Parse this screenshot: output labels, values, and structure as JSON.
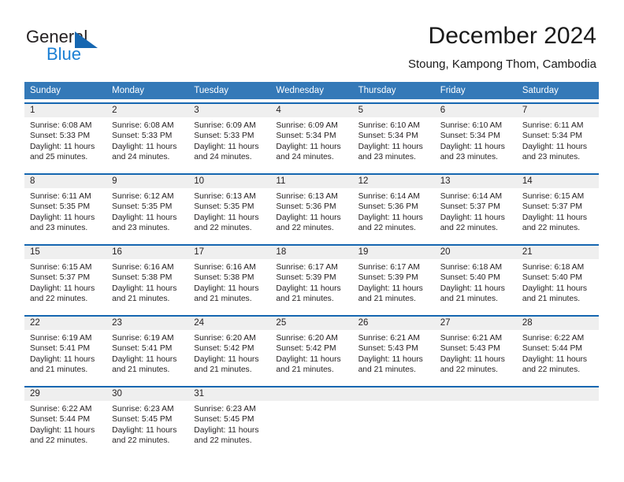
{
  "logo": {
    "word_one": "General",
    "word_two": "Blue",
    "triangle_icon": "triangle-icon",
    "blue": "#1667b1",
    "light_blue": "#1b7fd4"
  },
  "header": {
    "title": "December 2024",
    "subtitle": "Stoung, Kampong Thom, Cambodia"
  },
  "theme": {
    "header_bar": "#3479b8",
    "row_rule": "#1667b1",
    "day_band": "#efefef",
    "text": "#231f20"
  },
  "weekdays": [
    "Sunday",
    "Monday",
    "Tuesday",
    "Wednesday",
    "Thursday",
    "Friday",
    "Saturday"
  ],
  "weeks": [
    [
      {
        "day": "1",
        "sunrise": "Sunrise: 6:08 AM",
        "sunset": "Sunset: 5:33 PM",
        "daylight1": "Daylight: 11 hours",
        "daylight2": "and 25 minutes."
      },
      {
        "day": "2",
        "sunrise": "Sunrise: 6:08 AM",
        "sunset": "Sunset: 5:33 PM",
        "daylight1": "Daylight: 11 hours",
        "daylight2": "and 24 minutes."
      },
      {
        "day": "3",
        "sunrise": "Sunrise: 6:09 AM",
        "sunset": "Sunset: 5:33 PM",
        "daylight1": "Daylight: 11 hours",
        "daylight2": "and 24 minutes."
      },
      {
        "day": "4",
        "sunrise": "Sunrise: 6:09 AM",
        "sunset": "Sunset: 5:34 PM",
        "daylight1": "Daylight: 11 hours",
        "daylight2": "and 24 minutes."
      },
      {
        "day": "5",
        "sunrise": "Sunrise: 6:10 AM",
        "sunset": "Sunset: 5:34 PM",
        "daylight1": "Daylight: 11 hours",
        "daylight2": "and 23 minutes."
      },
      {
        "day": "6",
        "sunrise": "Sunrise: 6:10 AM",
        "sunset": "Sunset: 5:34 PM",
        "daylight1": "Daylight: 11 hours",
        "daylight2": "and 23 minutes."
      },
      {
        "day": "7",
        "sunrise": "Sunrise: 6:11 AM",
        "sunset": "Sunset: 5:34 PM",
        "daylight1": "Daylight: 11 hours",
        "daylight2": "and 23 minutes."
      }
    ],
    [
      {
        "day": "8",
        "sunrise": "Sunrise: 6:11 AM",
        "sunset": "Sunset: 5:35 PM",
        "daylight1": "Daylight: 11 hours",
        "daylight2": "and 23 minutes."
      },
      {
        "day": "9",
        "sunrise": "Sunrise: 6:12 AM",
        "sunset": "Sunset: 5:35 PM",
        "daylight1": "Daylight: 11 hours",
        "daylight2": "and 23 minutes."
      },
      {
        "day": "10",
        "sunrise": "Sunrise: 6:13 AM",
        "sunset": "Sunset: 5:35 PM",
        "daylight1": "Daylight: 11 hours",
        "daylight2": "and 22 minutes."
      },
      {
        "day": "11",
        "sunrise": "Sunrise: 6:13 AM",
        "sunset": "Sunset: 5:36 PM",
        "daylight1": "Daylight: 11 hours",
        "daylight2": "and 22 minutes."
      },
      {
        "day": "12",
        "sunrise": "Sunrise: 6:14 AM",
        "sunset": "Sunset: 5:36 PM",
        "daylight1": "Daylight: 11 hours",
        "daylight2": "and 22 minutes."
      },
      {
        "day": "13",
        "sunrise": "Sunrise: 6:14 AM",
        "sunset": "Sunset: 5:37 PM",
        "daylight1": "Daylight: 11 hours",
        "daylight2": "and 22 minutes."
      },
      {
        "day": "14",
        "sunrise": "Sunrise: 6:15 AM",
        "sunset": "Sunset: 5:37 PM",
        "daylight1": "Daylight: 11 hours",
        "daylight2": "and 22 minutes."
      }
    ],
    [
      {
        "day": "15",
        "sunrise": "Sunrise: 6:15 AM",
        "sunset": "Sunset: 5:37 PM",
        "daylight1": "Daylight: 11 hours",
        "daylight2": "and 22 minutes."
      },
      {
        "day": "16",
        "sunrise": "Sunrise: 6:16 AM",
        "sunset": "Sunset: 5:38 PM",
        "daylight1": "Daylight: 11 hours",
        "daylight2": "and 21 minutes."
      },
      {
        "day": "17",
        "sunrise": "Sunrise: 6:16 AM",
        "sunset": "Sunset: 5:38 PM",
        "daylight1": "Daylight: 11 hours",
        "daylight2": "and 21 minutes."
      },
      {
        "day": "18",
        "sunrise": "Sunrise: 6:17 AM",
        "sunset": "Sunset: 5:39 PM",
        "daylight1": "Daylight: 11 hours",
        "daylight2": "and 21 minutes."
      },
      {
        "day": "19",
        "sunrise": "Sunrise: 6:17 AM",
        "sunset": "Sunset: 5:39 PM",
        "daylight1": "Daylight: 11 hours",
        "daylight2": "and 21 minutes."
      },
      {
        "day": "20",
        "sunrise": "Sunrise: 6:18 AM",
        "sunset": "Sunset: 5:40 PM",
        "daylight1": "Daylight: 11 hours",
        "daylight2": "and 21 minutes."
      },
      {
        "day": "21",
        "sunrise": "Sunrise: 6:18 AM",
        "sunset": "Sunset: 5:40 PM",
        "daylight1": "Daylight: 11 hours",
        "daylight2": "and 21 minutes."
      }
    ],
    [
      {
        "day": "22",
        "sunrise": "Sunrise: 6:19 AM",
        "sunset": "Sunset: 5:41 PM",
        "daylight1": "Daylight: 11 hours",
        "daylight2": "and 21 minutes."
      },
      {
        "day": "23",
        "sunrise": "Sunrise: 6:19 AM",
        "sunset": "Sunset: 5:41 PM",
        "daylight1": "Daylight: 11 hours",
        "daylight2": "and 21 minutes."
      },
      {
        "day": "24",
        "sunrise": "Sunrise: 6:20 AM",
        "sunset": "Sunset: 5:42 PM",
        "daylight1": "Daylight: 11 hours",
        "daylight2": "and 21 minutes."
      },
      {
        "day": "25",
        "sunrise": "Sunrise: 6:20 AM",
        "sunset": "Sunset: 5:42 PM",
        "daylight1": "Daylight: 11 hours",
        "daylight2": "and 21 minutes."
      },
      {
        "day": "26",
        "sunrise": "Sunrise: 6:21 AM",
        "sunset": "Sunset: 5:43 PM",
        "daylight1": "Daylight: 11 hours",
        "daylight2": "and 21 minutes."
      },
      {
        "day": "27",
        "sunrise": "Sunrise: 6:21 AM",
        "sunset": "Sunset: 5:43 PM",
        "daylight1": "Daylight: 11 hours",
        "daylight2": "and 22 minutes."
      },
      {
        "day": "28",
        "sunrise": "Sunrise: 6:22 AM",
        "sunset": "Sunset: 5:44 PM",
        "daylight1": "Daylight: 11 hours",
        "daylight2": "and 22 minutes."
      }
    ],
    [
      {
        "day": "29",
        "sunrise": "Sunrise: 6:22 AM",
        "sunset": "Sunset: 5:44 PM",
        "daylight1": "Daylight: 11 hours",
        "daylight2": "and 22 minutes."
      },
      {
        "day": "30",
        "sunrise": "Sunrise: 6:23 AM",
        "sunset": "Sunset: 5:45 PM",
        "daylight1": "Daylight: 11 hours",
        "daylight2": "and 22 minutes."
      },
      {
        "day": "31",
        "sunrise": "Sunrise: 6:23 AM",
        "sunset": "Sunset: 5:45 PM",
        "daylight1": "Daylight: 11 hours",
        "daylight2": "and 22 minutes."
      },
      {
        "day": "",
        "sunrise": "",
        "sunset": "",
        "daylight1": "",
        "daylight2": ""
      },
      {
        "day": "",
        "sunrise": "",
        "sunset": "",
        "daylight1": "",
        "daylight2": ""
      },
      {
        "day": "",
        "sunrise": "",
        "sunset": "",
        "daylight1": "",
        "daylight2": ""
      },
      {
        "day": "",
        "sunrise": "",
        "sunset": "",
        "daylight1": "",
        "daylight2": ""
      }
    ]
  ]
}
